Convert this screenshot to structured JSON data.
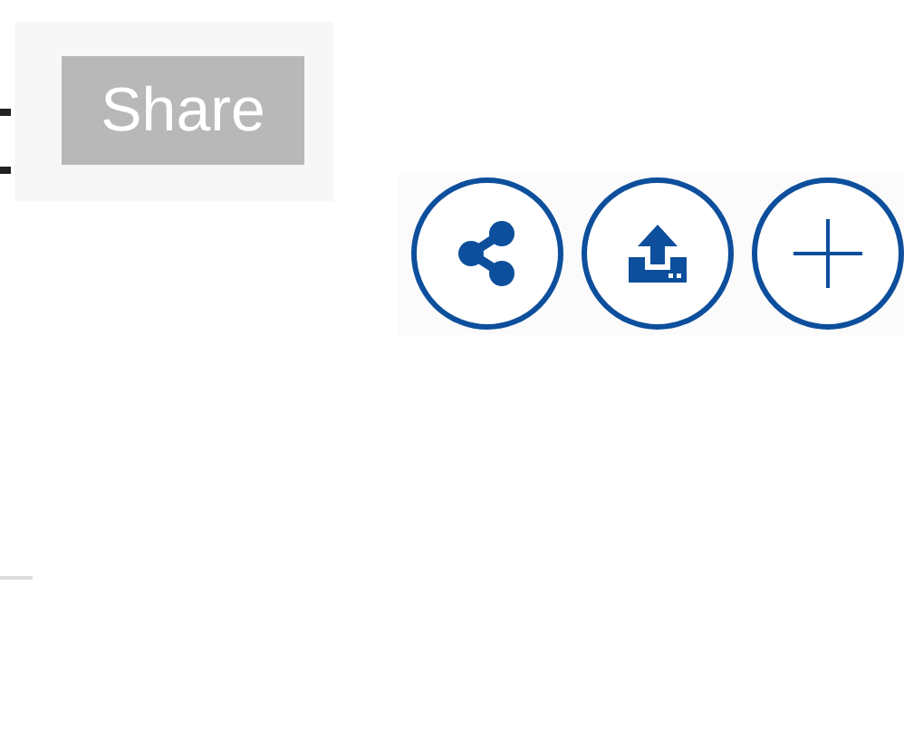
{
  "share_button": {
    "label": "Share"
  },
  "icon_buttons": [
    {
      "kind": "share"
    },
    {
      "kind": "upload"
    },
    {
      "kind": "add"
    }
  ]
}
